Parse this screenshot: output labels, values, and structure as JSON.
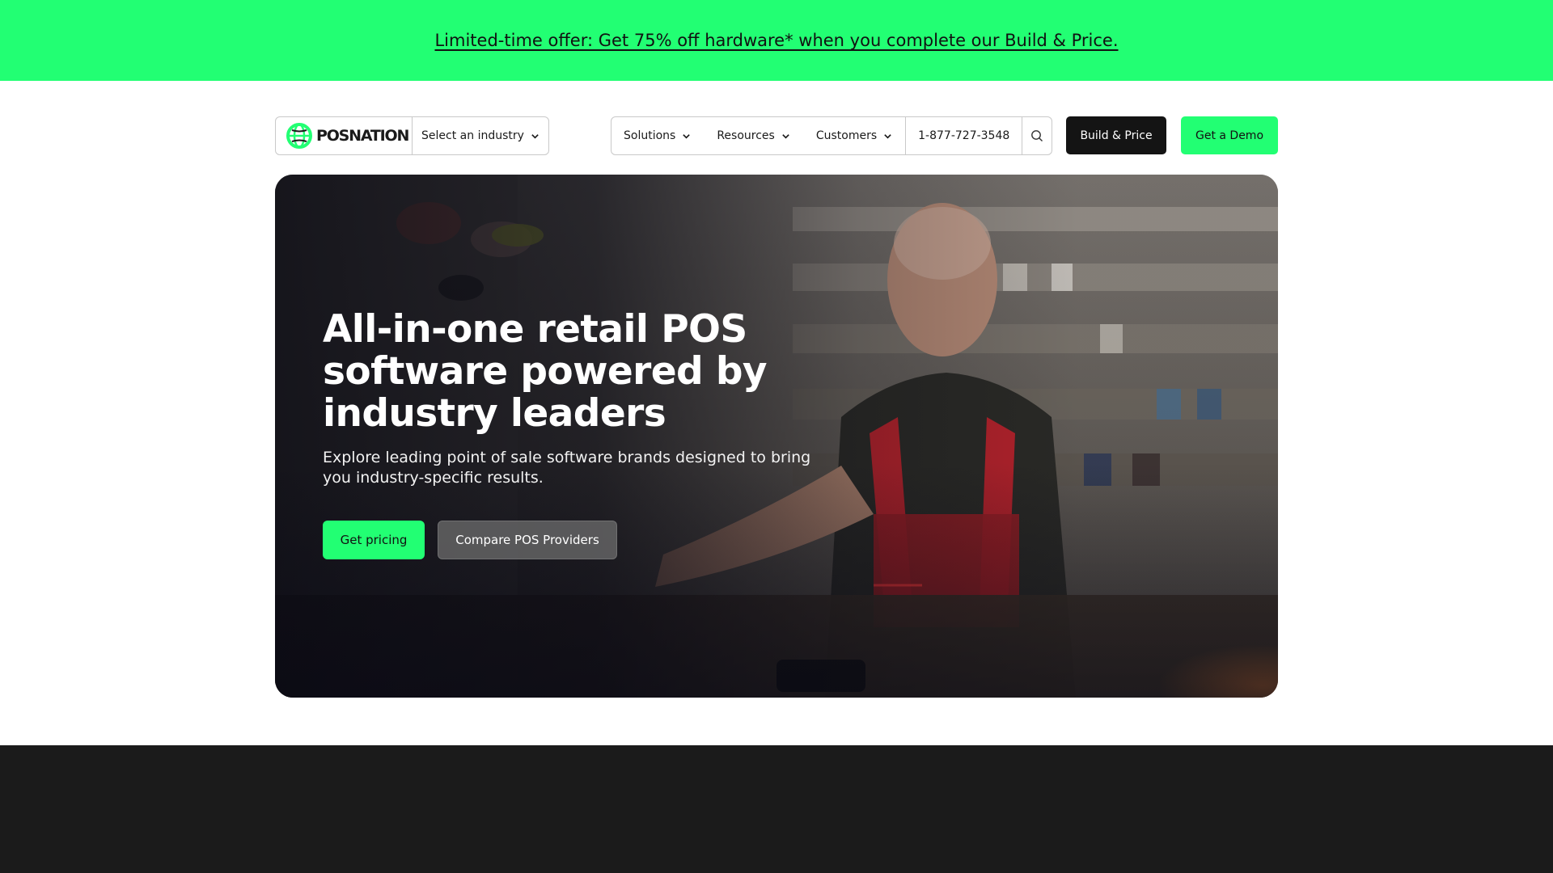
{
  "promo": {
    "text": "Limited-time offer: Get 75% off hardware* when you complete our Build & Price."
  },
  "header": {
    "logo_text": "POSNATION",
    "industry_select": "Select an industry",
    "menu": [
      {
        "label": "Solutions"
      },
      {
        "label": "Resources"
      },
      {
        "label": "Customers"
      }
    ],
    "phone": "1-877-727-3548",
    "build_price_label": "Build & Price",
    "demo_label": "Get a Demo"
  },
  "hero": {
    "title": "All-in-one retail POS software powered by industry leaders",
    "subtitle": "Explore leading point of sale software brands designed to bring you industry-specific results.",
    "primary_cta": "Get pricing",
    "secondary_cta": "Compare POS Providers"
  },
  "colors": {
    "accent_green": "#22ff73",
    "dark": "#141414",
    "footer_dark": "#1b1b1b"
  },
  "icons": {
    "logo": "posnation-globe-icon",
    "dropdown": "chevron-down-icon",
    "search": "search-icon"
  }
}
